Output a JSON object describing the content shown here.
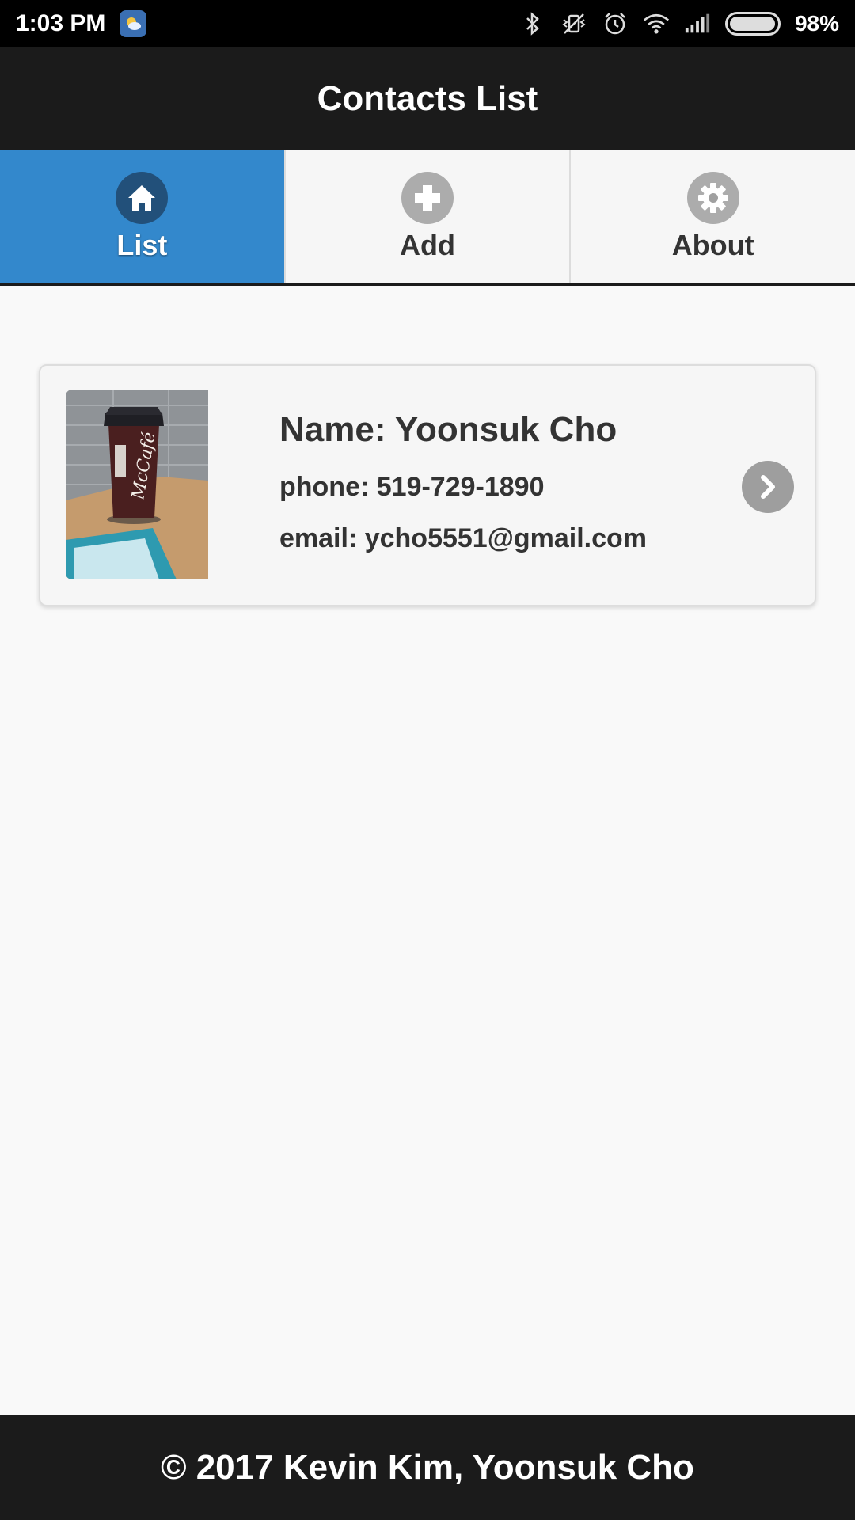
{
  "status_bar": {
    "time": "1:03 PM",
    "battery_percent": "98%",
    "battery_level": 0.98,
    "icons": [
      "weather-app-icon",
      "bluetooth-icon",
      "vibrate-off-icon",
      "alarm-icon",
      "wifi-icon",
      "signal-icon",
      "battery-icon"
    ]
  },
  "header": {
    "title": "Contacts List"
  },
  "tabs": [
    {
      "label": "List",
      "icon": "home-icon",
      "active": true
    },
    {
      "label": "Add",
      "icon": "plus-icon",
      "active": false
    },
    {
      "label": "About",
      "icon": "gear-icon",
      "active": false
    }
  ],
  "contacts": [
    {
      "name": "Name: Yoonsuk Cho",
      "phone": "phone: 519-729-1890",
      "email": "email: ycho5551@gmail.com",
      "photo": "coffee-cup-photo"
    }
  ],
  "footer": {
    "text": "© 2017 Kevin Kim, Yoonsuk Cho"
  },
  "colors": {
    "accent": "#3388cc",
    "header_bg": "#1b1b1b",
    "background": "#f9f9f9"
  }
}
